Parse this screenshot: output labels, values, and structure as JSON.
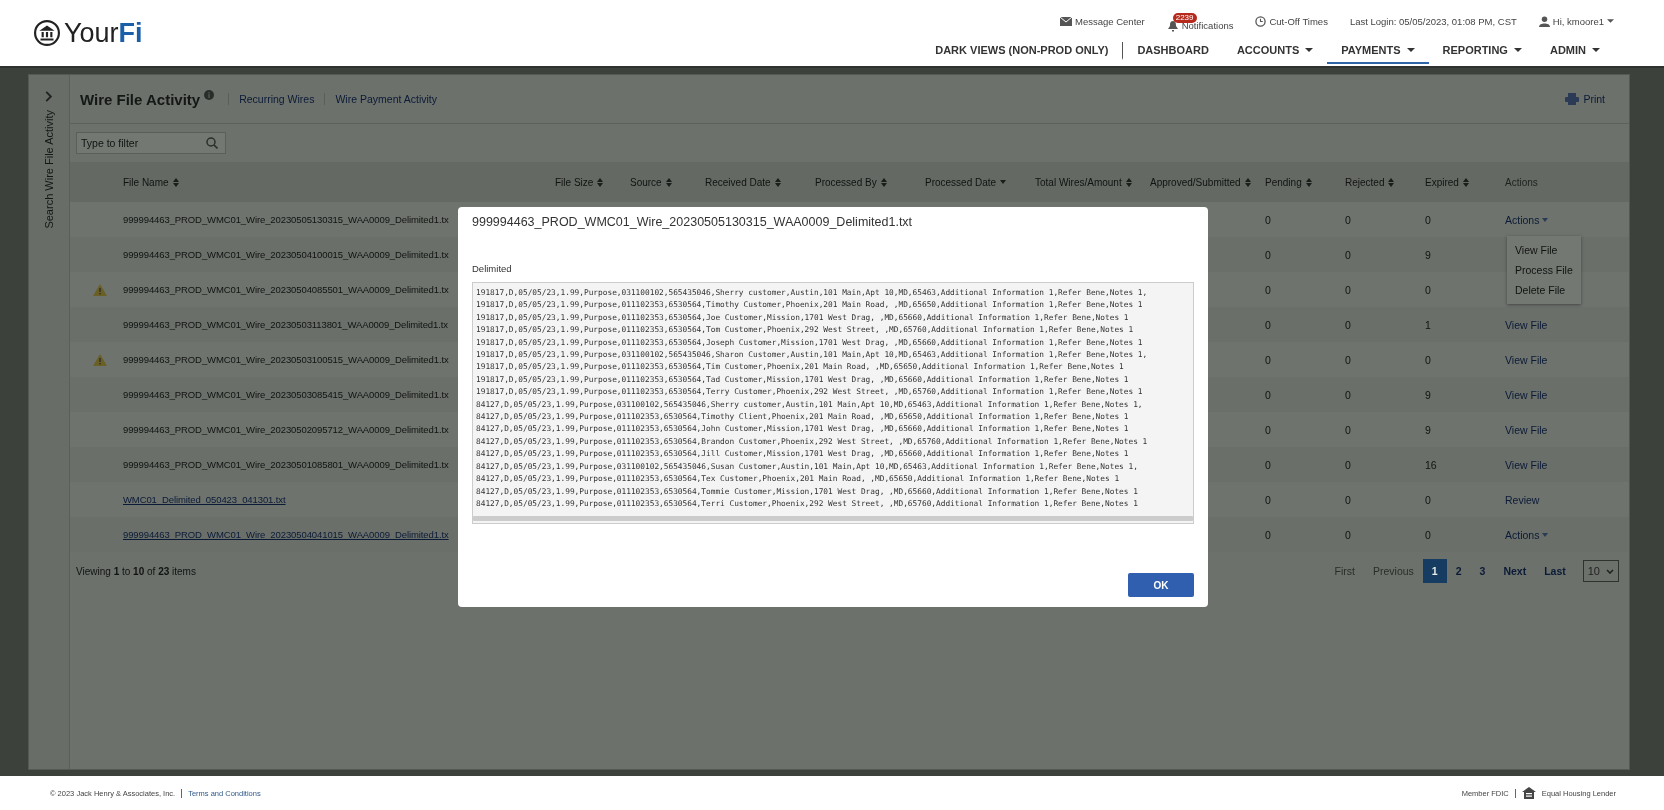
{
  "header": {
    "logo": "Your**Fi**",
    "utilities": [
      {
        "kind": "message",
        "label": "Message Center"
      },
      {
        "kind": "notifications",
        "label": "Notifications",
        "badge": "2239"
      },
      {
        "kind": "clock",
        "label": "Cut-Off Times"
      },
      {
        "kind": "text",
        "label": "Last Login: 05/05/2023, 01:08 PM, CST"
      },
      {
        "kind": "user",
        "label": "Hi, kmoore1"
      }
    ],
    "nav": [
      {
        "label": "DARK VIEWS (NON-PROD ONLY)",
        "dropdown": false,
        "selected": false
      },
      {
        "label": "DASHBOARD",
        "dropdown": false,
        "selected": false
      },
      {
        "label": "ACCOUNTS",
        "dropdown": true,
        "selected": false
      },
      {
        "label": "PAYMENTS",
        "dropdown": true,
        "selected": true
      },
      {
        "label": "REPORTING",
        "dropdown": true,
        "selected": false
      },
      {
        "label": "ADMIN",
        "dropdown": true,
        "selected": false
      }
    ]
  },
  "sidebar": {
    "label": "Search Wire File Activity"
  },
  "page": {
    "title": "Wire File Activity",
    "links": [
      "Recurring Wires",
      "Wire Payment Activity"
    ],
    "print": "Print",
    "filter": {
      "placeholder": "Type to filter"
    }
  },
  "table": {
    "columns": [
      {
        "label": "File Name",
        "sortable": true,
        "sorted_descending": false
      },
      {
        "label": "File Size",
        "sortable": true,
        "sorted_descending": false
      },
      {
        "label": "Source",
        "sortable": true,
        "sorted_descending": false
      },
      {
        "label": "Received Date",
        "sortable": true,
        "sorted_descending": false
      },
      {
        "label": "Processed By",
        "sortable": true,
        "sorted_descending": false
      },
      {
        "label": "Processed Date",
        "sortable": true,
        "sorted_descending": true
      },
      {
        "label": "Total Wires/Amount",
        "sortable": true,
        "sorted_descending": false
      },
      {
        "label": "Approved/Submitted",
        "sortable": true,
        "sorted_descending": false
      },
      {
        "label": "Pending",
        "sortable": true,
        "sorted_descending": false
      },
      {
        "label": "Rejected",
        "sortable": true,
        "sorted_descending": false
      },
      {
        "label": "Expired",
        "sortable": true,
        "sorted_descending": false
      },
      {
        "label": "Actions",
        "sortable": false,
        "sorted_descending": false
      }
    ],
    "rows": [
      {
        "warning": false,
        "file_name": "999994463_PROD_WMC01_Wire_20230505130315_WAA0009_Delimited1.tx",
        "link": false,
        "pending": "0",
        "rejected": "0",
        "expired": "0",
        "action": {
          "kind": "menu",
          "label": "Actions",
          "menu_items": [
            "View File",
            "Process File",
            "Delete File"
          ]
        }
      },
      {
        "warning": false,
        "file_name": "999994463_PROD_WMC01_Wire_20230504100015_WAA0009_Delimited1.tx",
        "link": false,
        "pending": "0",
        "rejected": "0",
        "expired": "9",
        "action": {
          "kind": "none"
        }
      },
      {
        "warning": true,
        "file_name": "999994463_PROD_WMC01_Wire_20230504085501_WAA0009_Delimited1.tx",
        "link": false,
        "pending": "0",
        "rejected": "0",
        "expired": "0",
        "action": {
          "kind": "none"
        }
      },
      {
        "warning": false,
        "file_name": "999994463_PROD_WMC01_Wire_20230503113801_WAA0009_Delimited1.tx",
        "link": false,
        "pending": "0",
        "rejected": "0",
        "expired": "1",
        "action": {
          "kind": "link",
          "label": "View File"
        }
      },
      {
        "warning": true,
        "file_name": "999994463_PROD_WMC01_Wire_20230503100515_WAA0009_Delimited1.tx",
        "link": false,
        "pending": "0",
        "rejected": "0",
        "expired": "0",
        "action": {
          "kind": "link",
          "label": "View File"
        }
      },
      {
        "warning": false,
        "file_name": "999994463_PROD_WMC01_Wire_20230503085415_WAA0009_Delimited1.tx",
        "link": false,
        "pending": "0",
        "rejected": "0",
        "expired": "9",
        "action": {
          "kind": "link",
          "label": "View File"
        }
      },
      {
        "warning": false,
        "file_name": "999994463_PROD_WMC01_Wire_20230502095712_WAA0009_Delimited1.tx",
        "link": false,
        "pending": "0",
        "rejected": "0",
        "expired": "9",
        "action": {
          "kind": "link",
          "label": "View File"
        }
      },
      {
        "warning": false,
        "file_name": "999994463_PROD_WMC01_Wire_20230501085801_WAA0009_Delimited1.tx",
        "link": false,
        "pending": "0",
        "rejected": "0",
        "expired": "16",
        "action": {
          "kind": "link",
          "label": "View File"
        }
      },
      {
        "warning": false,
        "file_name": "WMC01_Delimited_050423_041301.txt",
        "link": true,
        "pending": "0",
        "rejected": "0",
        "expired": "0",
        "action": {
          "kind": "link",
          "label": "Review"
        }
      },
      {
        "warning": false,
        "file_name": "999994463_PROD_WMC01_Wire_20230504041015_WAA0009_Delimited1.tx",
        "link": true,
        "pending": "0",
        "rejected": "0",
        "expired": "0",
        "action": {
          "kind": "menu",
          "label": "Actions"
        }
      }
    ]
  },
  "pagination": {
    "summary": "Viewing **1** to **10** of **23** items",
    "pages": [
      {
        "label": "First",
        "disabled": true,
        "selected": false
      },
      {
        "label": "Previous",
        "disabled": true,
        "selected": false
      },
      {
        "label": "1",
        "disabled": false,
        "selected": true
      },
      {
        "label": "2",
        "disabled": false,
        "selected": false
      },
      {
        "label": "3",
        "disabled": false,
        "selected": false
      },
      {
        "label": "Next",
        "disabled": false,
        "selected": false
      },
      {
        "label": "Last",
        "disabled": false,
        "selected": false
      }
    ],
    "page_size": "10"
  },
  "modal": {
    "title": "999994463_PROD_WMC01_Wire_20230505130315_WAA0009_Delimited1.txt",
    "section_label": "Delimited",
    "lines": [
      "191817,D,05/05/23,1.99,Purpose,031100102,565435046,Sherry customer,Austin,101 Main,Apt 10,MD,65463,Additional Information 1,Refer Bene,Notes 1,",
      "191817,D,05/05/23,1.99,Purpose,011102353,6530564,Timothy Customer,Phoenix,201 Main Road, ,MD,65650,Additional Information 1,Refer Bene,Notes 1",
      "191817,D,05/05/23,1.99,Purpose,011102353,6530564,Joe Customer,Mission,1701 West Drag, ,MD,65660,Additional Information 1,Refer Bene,Notes 1",
      "191817,D,05/05/23,1.99,Purpose,011102353,6530564,Tom Customer,Phoenix,292 West Street, ,MD,65760,Additional Information 1,Refer Bene,Notes 1",
      "191817,D,05/05/23,1.99,Purpose,011102353,6530564,Joseph Customer,Mission,1701 West Drag, ,MD,65660,Additional Information 1,Refer Bene,Notes 1",
      "191817,D,05/05/23,1.99,Purpose,031100102,565435046,Sharon Customer,Austin,101 Main,Apt 10,MD,65463,Additional Information 1,Refer Bene,Notes 1,",
      "191817,D,05/05/23,1.99,Purpose,011102353,6530564,Tim Customer,Phoenix,201 Main Road, ,MD,65650,Additional Information 1,Refer Bene,Notes 1",
      "191817,D,05/05/23,1.99,Purpose,011102353,6530564,Tad Customer,Mission,1701 West Drag, ,MD,65660,Additional Information 1,Refer Bene,Notes 1",
      "191817,D,05/05/23,1.99,Purpose,011102353,6530564,Terry Customer,Phoenix,292 West Street, ,MD,65760,Additional Information 1,Refer Bene,Notes 1",
      "84127,D,05/05/23,1.99,Purpose,031100102,565435046,Sherry customer,Austin,101 Main,Apt 10,MD,65463,Additional Information 1,Refer Bene,Notes 1,",
      "84127,D,05/05/23,1.99,Purpose,011102353,6530564,Timothy Client,Phoenix,201 Main Road, ,MD,65650,Additional Information 1,Refer Bene,Notes 1",
      "84127,D,05/05/23,1.99,Purpose,011102353,6530564,John Customer,Mission,1701 West Drag, ,MD,65660,Additional Information 1,Refer Bene,Notes 1",
      "84127,D,05/05/23,1.99,Purpose,011102353,6530564,Brandon Customer,Phoenix,292 West Street, ,MD,65760,Additional Information 1,Refer Bene,Notes 1",
      "84127,D,05/05/23,1.99,Purpose,011102353,6530564,Jill Customer,Mission,1701 West Drag, ,MD,65660,Additional Information 1,Refer Bene,Notes 1",
      "84127,D,05/05/23,1.99,Purpose,031100102,565435046,Susan Customer,Austin,101 Main,Apt 10,MD,65463,Additional Information 1,Refer Bene,Notes 1,",
      "84127,D,05/05/23,1.99,Purpose,011102353,6530564,Tex Customer,Phoenix,201 Main Road, ,MD,65650,Additional Information 1,Refer Bene,Notes 1",
      "84127,D,05/05/23,1.99,Purpose,011102353,6530564,Tommie Customer,Mission,1701 West Drag, ,MD,65660,Additional Information 1,Refer Bene,Notes 1",
      "84127,D,05/05/23,1.99,Purpose,011102353,6530564,Terri Customer,Phoenix,292 West Street, ,MD,65760,Additional Information 1,Refer Bene,Notes 1"
    ],
    "ok": "OK"
  },
  "footer": {
    "copyright": "© 2023 Jack Henry & Associates, Inc.",
    "terms": "Terms and Conditions",
    "fdic": "Member FDIC",
    "housing": "Equal Housing Lender"
  }
}
